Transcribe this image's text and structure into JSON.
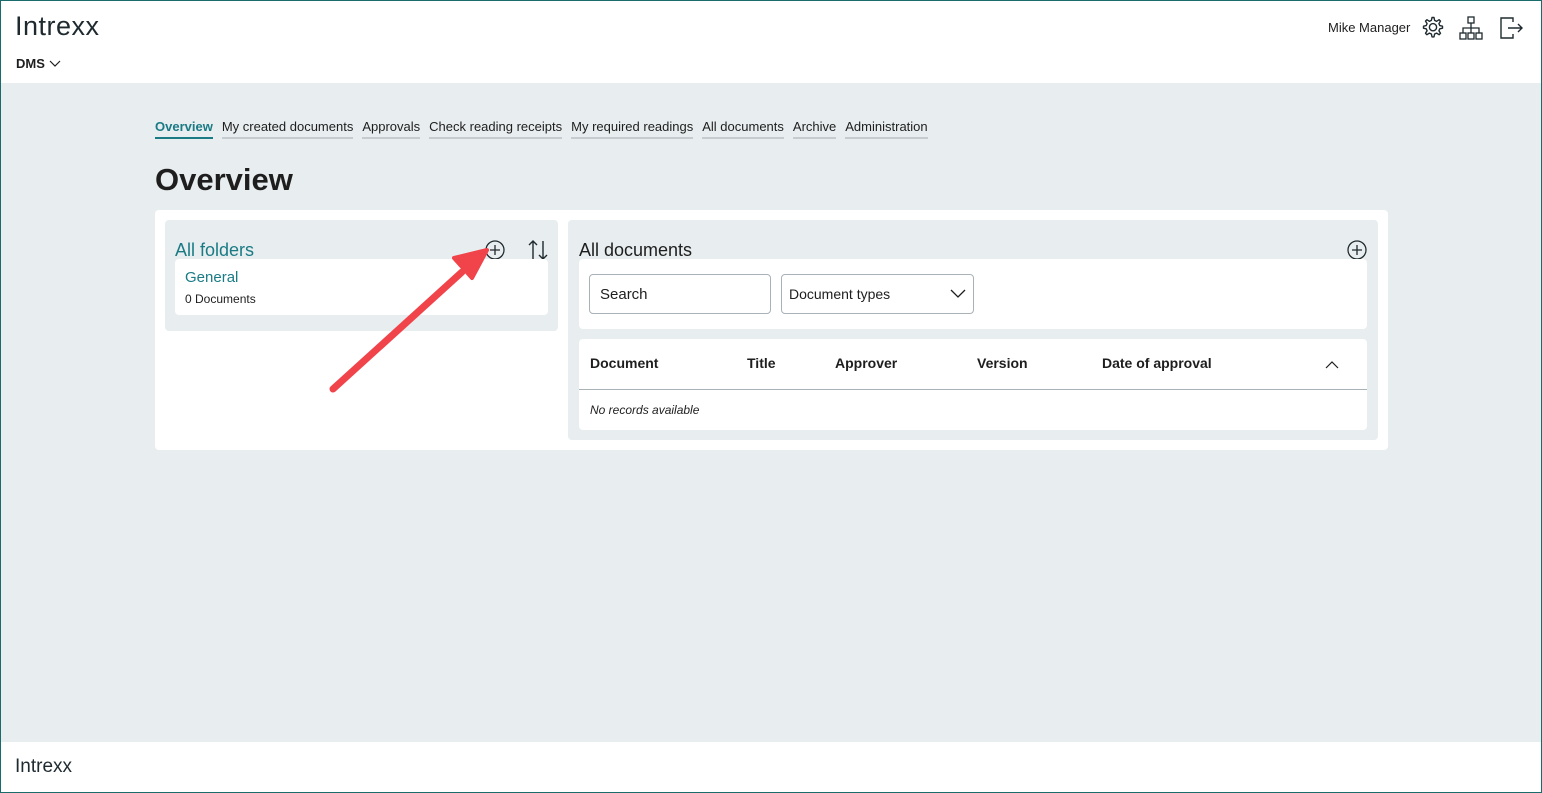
{
  "header": {
    "logo": "Intrexx",
    "app_name": "DMS",
    "user_name": "Mike Manager",
    "icons": [
      "gear-icon",
      "sitemap-icon",
      "logout-icon"
    ]
  },
  "tabs": [
    {
      "label": "Overview",
      "active": true
    },
    {
      "label": "My created documents",
      "active": false
    },
    {
      "label": "Approvals",
      "active": false
    },
    {
      "label": "Check reading receipts",
      "active": false
    },
    {
      "label": "My required readings",
      "active": false
    },
    {
      "label": "All documents",
      "active": false
    },
    {
      "label": "Archive",
      "active": false
    },
    {
      "label": "Administration",
      "active": false
    }
  ],
  "page_title": "Overview",
  "folders": {
    "title": "All folders",
    "items": [
      {
        "name": "General",
        "count": "0 Documents"
      }
    ]
  },
  "documents": {
    "title": "All documents",
    "search_placeholder": "Search",
    "document_types_label": "Document types",
    "columns": [
      "Document",
      "Title",
      "Approver",
      "Version",
      "Date of approval"
    ],
    "empty_text": "No records available"
  },
  "footer": {
    "logo": "Intrexx"
  },
  "colors": {
    "accent": "#1a7b85",
    "background": "#e8edef",
    "annotation_arrow": "#f0434a"
  }
}
